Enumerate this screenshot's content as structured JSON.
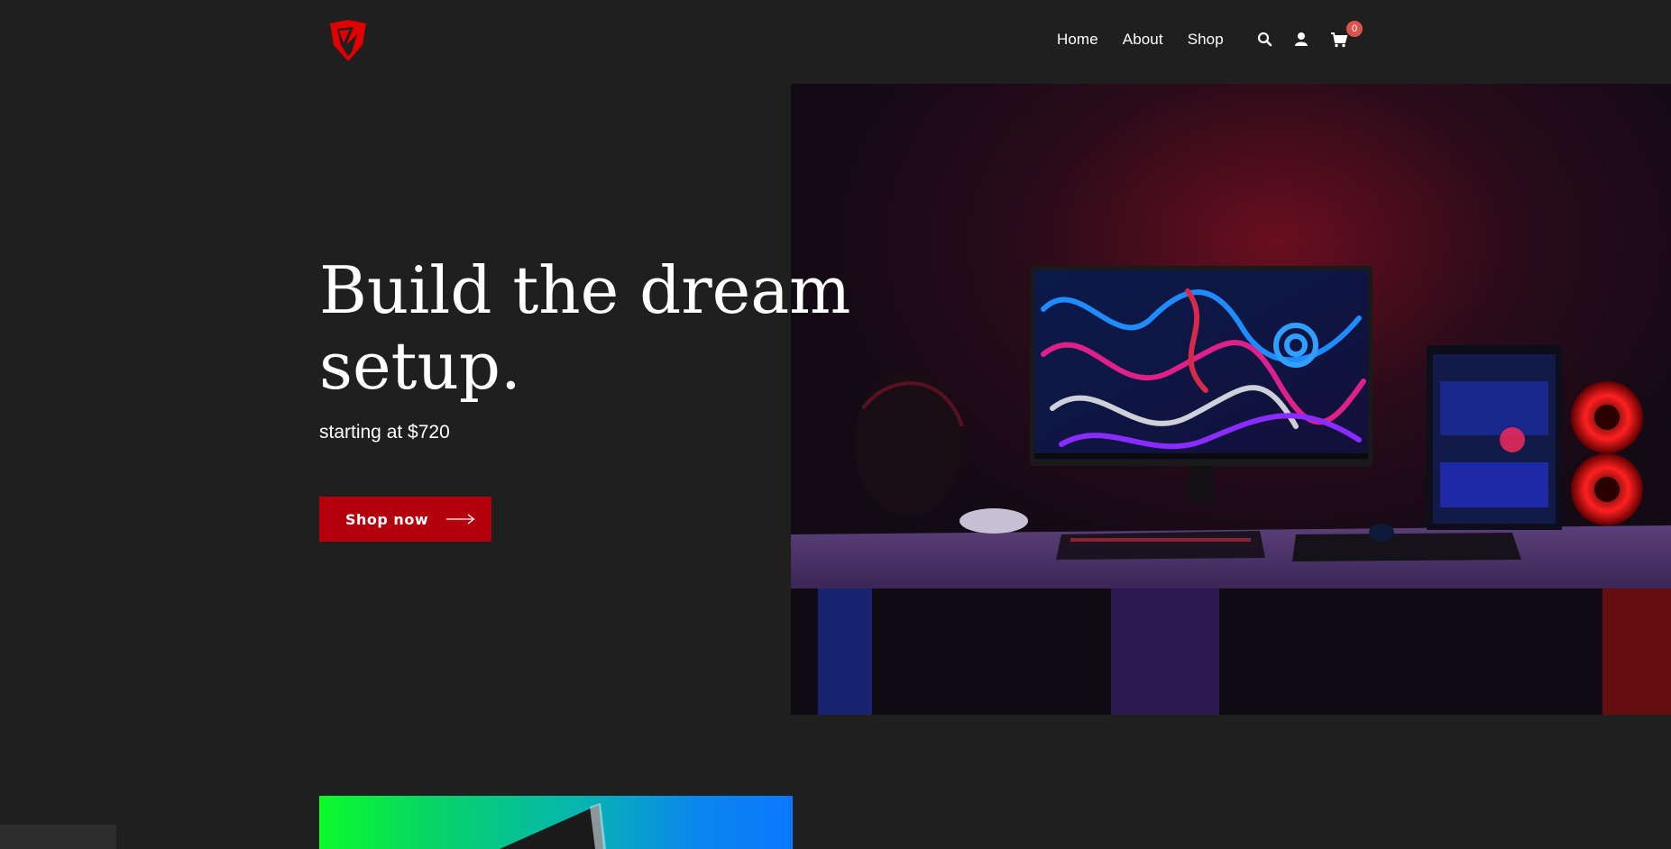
{
  "brand": {
    "logo_icon": "shield-logo-icon",
    "accent_color": "#e00000"
  },
  "nav": {
    "items": [
      {
        "label": "Home"
      },
      {
        "label": "About"
      },
      {
        "label": "Shop"
      }
    ]
  },
  "header_actions": {
    "search_icon": "search-icon",
    "user_icon": "user-icon",
    "cart_icon": "cart-icon",
    "cart_count": "0"
  },
  "hero": {
    "title": "Build the dream setup.",
    "subtitle": "starting at $720",
    "cta_label": "Shop now",
    "cta_color": "#b3000c"
  }
}
